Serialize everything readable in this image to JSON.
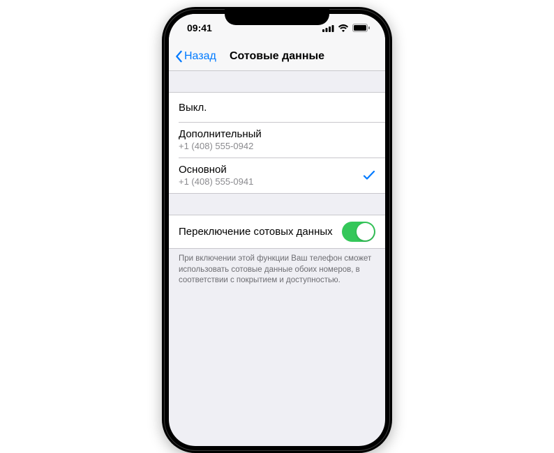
{
  "statusBar": {
    "time": "09:41"
  },
  "nav": {
    "back": "Назад",
    "title": "Сотовые данные"
  },
  "lines": {
    "off": "Выкл.",
    "secondary": {
      "label": "Дополнительный",
      "number": "+1 (408) 555-0942"
    },
    "primary": {
      "label": "Основной",
      "number": "+1 (408) 555-0941"
    }
  },
  "switching": {
    "label": "Переключение сотовых данных",
    "enabled": true,
    "footer": "При включении этой функции Ваш телефон сможет использовать сотовые данные обоих номеров, в соответствии с покрытием и доступностью."
  }
}
